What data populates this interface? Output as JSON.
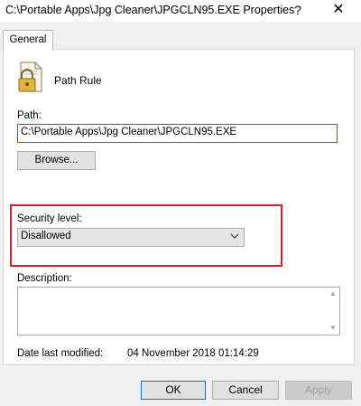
{
  "window": {
    "title": "C:\\Portable Apps\\Jpg Cleaner\\JPGCLN95.EXE Properties",
    "help_glyph": "?",
    "close_glyph": "✕"
  },
  "tabs": [
    {
      "label": "General",
      "selected": true
    }
  ],
  "rule": {
    "icon": "document-lock-icon",
    "title": "Path Rule"
  },
  "path": {
    "label": "Path:",
    "value": "C:\\Portable Apps\\Jpg Cleaner\\JPGCLN95.EXE"
  },
  "browse_label": "Browse...",
  "security": {
    "label": "Security level:",
    "value": "Disallowed",
    "highlight_color": "#c8262c"
  },
  "description": {
    "label": "Description:",
    "value": ""
  },
  "date_modified": {
    "label": "Date last modified:",
    "value": "04 November 2018  01:14:29"
  },
  "buttons": {
    "ok": "OK",
    "cancel": "Cancel",
    "apply": "Apply"
  }
}
